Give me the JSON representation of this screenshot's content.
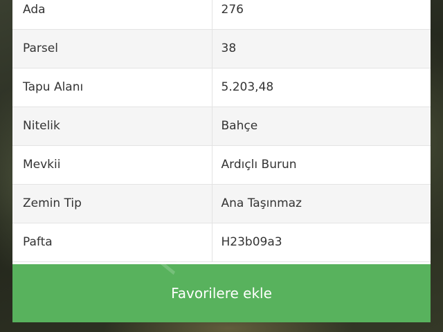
{
  "parcel_info": {
    "rows": [
      {
        "label": "Ada",
        "value": "276"
      },
      {
        "label": "Parsel",
        "value": "38"
      },
      {
        "label": "Tapu Alanı",
        "value": "5.203,48"
      },
      {
        "label": "Nitelik",
        "value": "Bahçe"
      },
      {
        "label": "Mevkii",
        "value": "Ardıçlı Burun"
      },
      {
        "label": "Zemin Tip",
        "value": "Ana Taşınmaz"
      },
      {
        "label": "Pafta",
        "value": "H23b09a3"
      }
    ]
  },
  "actions": {
    "favorite_label": "Favorilere ekle",
    "button_color": "#58b25d"
  }
}
